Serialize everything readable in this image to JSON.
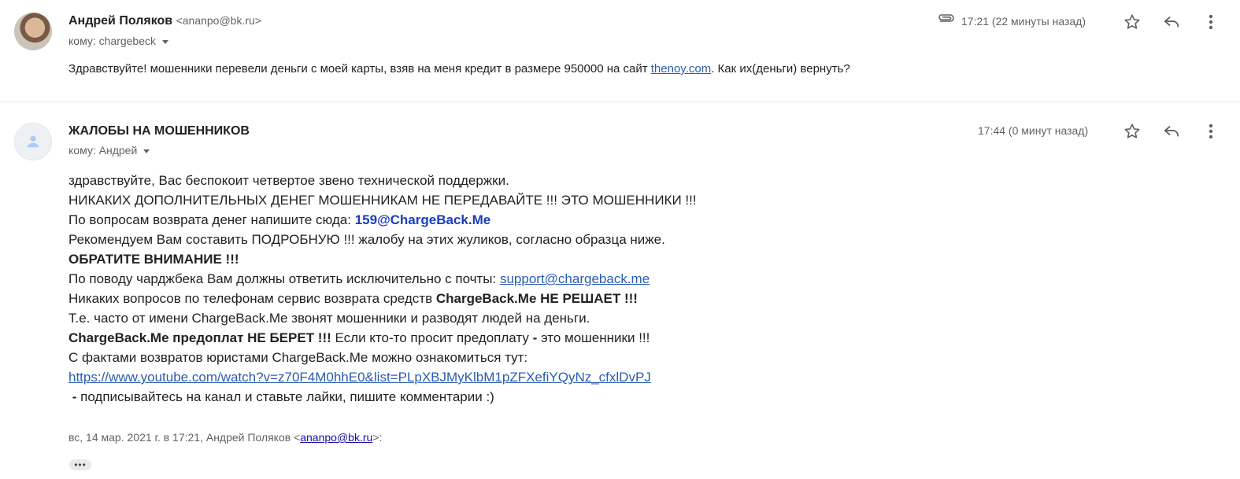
{
  "message1": {
    "sender_name": "Андрей Поляков",
    "sender_email": "<ananpo@bk.ru>",
    "to_line": "кому: chargebeck",
    "time": "17:21 (22 минуты назад)",
    "body_pre": "Здравствуйте! мошенники перевели деньги с моей карты, взяв на меня кредит в размере 950000 на сайт ",
    "body_link": "thenoy.com",
    "body_post": ". Как их(деньги) вернуть?",
    "icons": [
      "attachment-icon",
      "star-icon",
      "reply-icon",
      "more-vert-icon"
    ]
  },
  "message2": {
    "sender_name": "ЖАЛОБЫ НА МОШЕННИКОВ",
    "to_line": "кому: Андрей",
    "time": "17:44 (0 минут назад)",
    "lines": {
      "l1": "здравствуйте, Вас беспокоит четвертое звено технической поддержки.",
      "l2": "НИКАКИХ ДОПОЛНИТЕЛЬНЫХ ДЕНЕГ МОШЕННИКАМ НЕ ПЕРЕДАВАЙТЕ !!! ЭТО МОШЕННИКИ !!!",
      "l3_pre": "По вопросам возврата денег напишите сюда: ",
      "l3_email": "159@ChargeBack.Me",
      "l4": "Рекомендуем Вам составить ПОДРОБНУЮ !!! жалобу на этих жуликов, согласно образца ниже.",
      "l5": "ОБРАТИТЕ ВНИМАНИЕ !!!",
      "l6_pre": "По поводу чарджбека Вам должны ответить исключительно с почты: ",
      "l6_link": "support@chargeback.me",
      "l7_pre": "Никаких вопросов по телефонам сервис возврата средств ",
      "l7_bold": "ChargeBack.Me НЕ РЕШАЕТ !!!",
      "l8": "Т.е. часто от имени ChargeBack.Me звонят мошенники и разводят людей на деньги.",
      "l9_bold": "ChargeBack.Me предоплат НЕ БЕРЕТ !!!",
      "l9_mid": " Если кто-то просит предоплату ",
      "l9_dash": "-",
      "l9_post": " это мошенники !!!",
      "l10": "С фактами возвратов юристами ChargeBack.Me можно ознакомиться тут:",
      "l11_link": "https://www.youtube.com/watch?v=z70F4M0hhE0&list=PLpXBJMyKlbM1pZFXefiYQyNz_cfxlDvPJ",
      "l12_dash": " -",
      "l12_post": " подписывайтесь на канал и ставьте лайки, пишите комментарии :)"
    },
    "quote_pre": "вс, 14 мар. 2021 г. в 17:21, Андрей Поляков <",
    "quote_email": "ananpo@bk.ru",
    "quote_post": ">:",
    "collapsed_dots": "•••",
    "icons": [
      "star-icon",
      "reply-icon",
      "more-vert-icon"
    ]
  }
}
